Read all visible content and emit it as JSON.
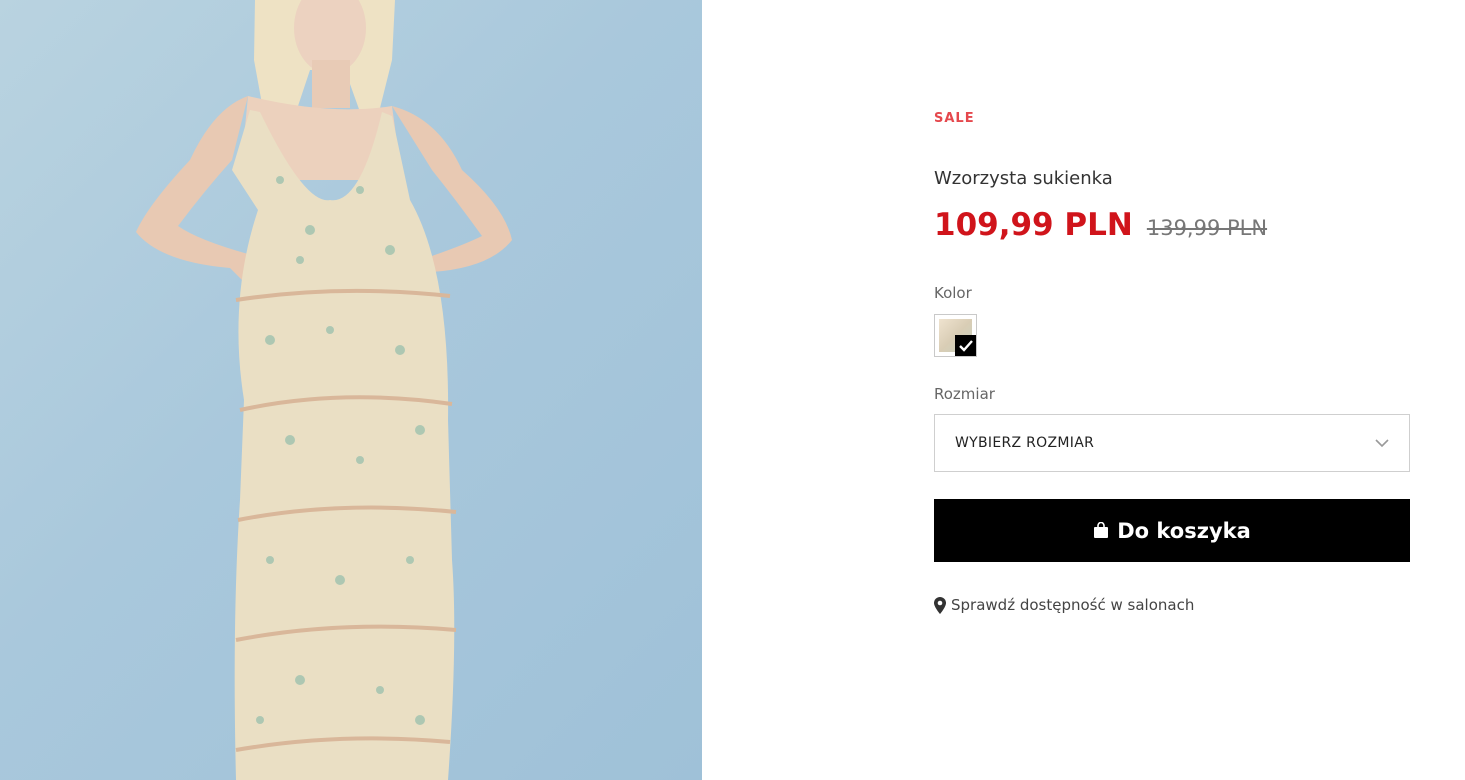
{
  "product": {
    "badge": "SALE",
    "name": "Wzorzysta sukienka",
    "price_current": "109,99 PLN",
    "price_old": "139,99 PLN",
    "image_icon": "product-photo-dress"
  },
  "options": {
    "color_label": "Kolor",
    "color_selected_icon": "checkmark-icon",
    "size_label": "Rozmiar",
    "size_select_value": "WYBIERZ ROZMIAR",
    "size_select_icon": "chevron-down-icon"
  },
  "actions": {
    "add_to_cart_label": "Do koszyka",
    "add_to_cart_icon": "shopping-bag-icon",
    "store_availability_label": "Sprawdź dostępność w salonach",
    "store_availability_icon": "map-pin-icon"
  },
  "colors": {
    "sale": "#e5484d",
    "price": "#d0141b",
    "button_bg": "#000000",
    "button_text": "#ffffff",
    "photo_background": "#a9c8dc"
  }
}
